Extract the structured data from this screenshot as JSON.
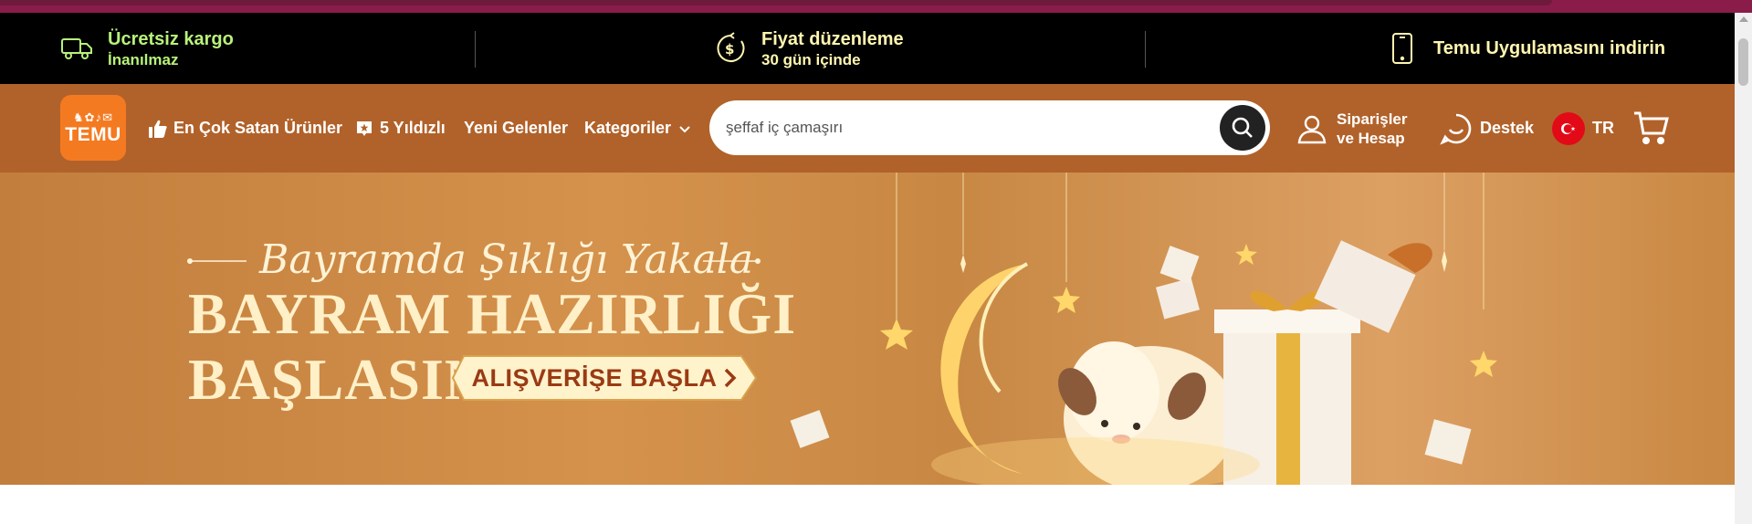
{
  "promo_bar": {
    "free_shipping": {
      "title": "Ücretsiz kargo",
      "subtitle": "İnanılmaz",
      "icon": "truck-icon"
    },
    "price_adjust": {
      "title": "Fiyat düzenleme",
      "subtitle": "30 gün içinde",
      "icon": "dollar-clock-icon"
    },
    "app": {
      "title": "Temu Uygulamasını indirin",
      "icon": "phone-icon"
    }
  },
  "header": {
    "logo": {
      "glyphs": "♞✿♪✉",
      "word": "TEMU"
    },
    "nav": {
      "best_sellers": "En Çok Satan Ürünler",
      "five_stars": "5 Yıldızlı",
      "new_arrivals": "Yeni Gelenler",
      "categories": "Kategoriler"
    },
    "search": {
      "placeholder": "şeffaf iç çamaşırı"
    },
    "account": {
      "line1": "Siparişler",
      "line2": "ve Hesap"
    },
    "support": "Destek",
    "language": "TR"
  },
  "banner": {
    "script_title": "Bayramda Şıklığı Yakala",
    "headline_1": "BAYRAM HAZIRLIĞI",
    "headline_2": "BAŞLASIN",
    "cta": "ALIŞVERİŞE BAŞLA"
  },
  "colors": {
    "promo_bg": "#000000",
    "promo_green": "#b8f27a",
    "promo_yellow": "#fff6b0",
    "header_bg": "#b1622a",
    "logo_bg": "#f47a21",
    "banner_gold": "#d4924c"
  }
}
